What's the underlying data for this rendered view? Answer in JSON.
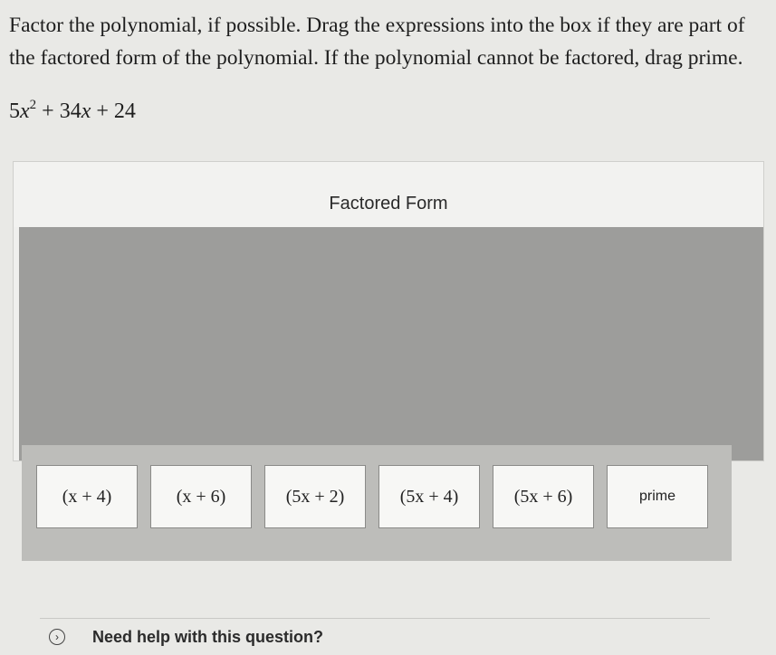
{
  "question": {
    "instructions": "Factor the polynomial, if possible. Drag the expressions into the box if they are part of the factored form of the polynomial. If the polynomial cannot be factored, drag prime.",
    "polynomial": {
      "coef": "5",
      "var": "x",
      "exp": "2",
      "rest_a": " + 34",
      "rest_var": "x",
      "rest_b": " + 24"
    }
  },
  "factored": {
    "header": "Factored Form"
  },
  "tiles": [
    {
      "label": "(x + 4)"
    },
    {
      "label": "(x + 6)"
    },
    {
      "label": "(5x + 2)"
    },
    {
      "label": "(5x + 4)"
    },
    {
      "label": "(5x + 6)"
    },
    {
      "label": "prime"
    }
  ],
  "help": {
    "label": "Need help with this question?",
    "icon": "chevron-right-icon"
  }
}
